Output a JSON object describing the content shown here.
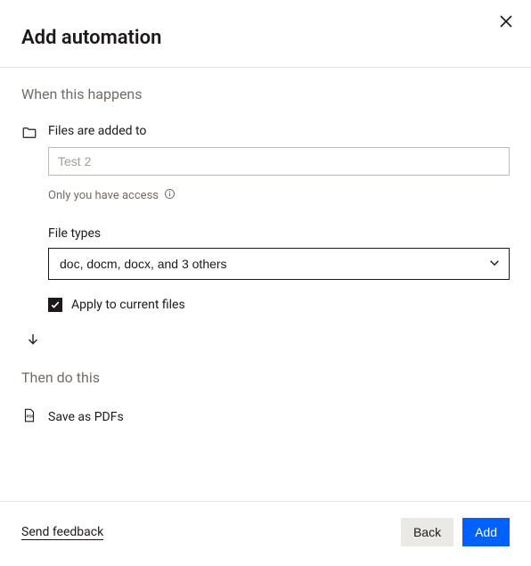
{
  "header": {
    "title": "Add automation"
  },
  "trigger": {
    "section_heading": "When this happens",
    "label": "Files are added to",
    "folder_placeholder": "Test 2",
    "folder_value": "",
    "access_text": "Only you have access",
    "file_types_label": "File types",
    "file_types_value": "doc, docm, docx, and 3 others",
    "apply_current_label": "Apply to current files",
    "apply_current_checked": true
  },
  "action": {
    "section_heading": "Then do this",
    "label": "Save as PDFs"
  },
  "footer": {
    "feedback": "Send feedback",
    "back": "Back",
    "add": "Add"
  }
}
